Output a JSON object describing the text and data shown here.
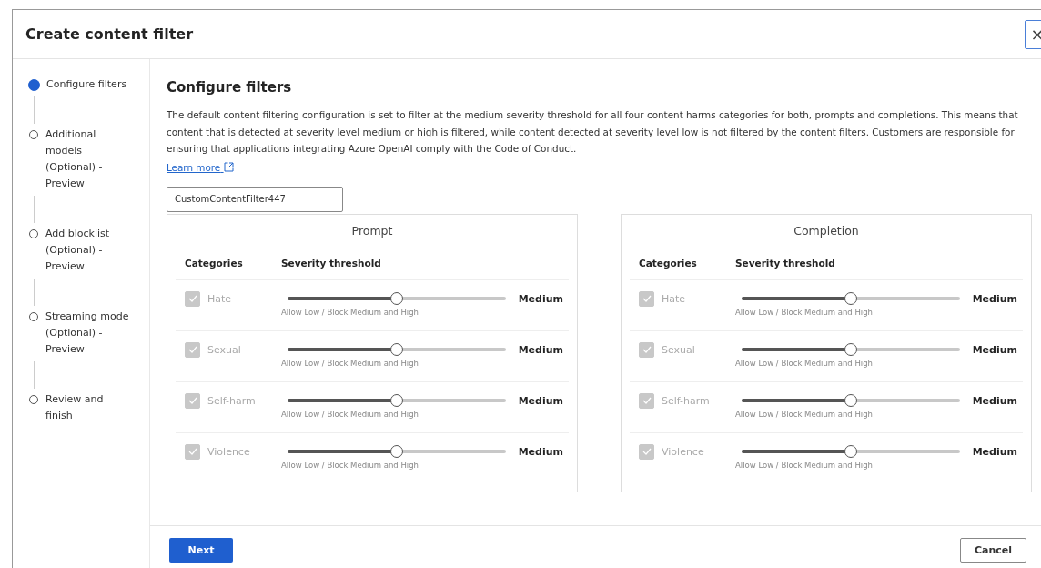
{
  "dialog": {
    "title": "Create content filter",
    "close": "×"
  },
  "steps": [
    {
      "label": "Configure filters",
      "selected": true
    },
    {
      "label": "Additional models (Optional) - Preview",
      "selected": false
    },
    {
      "label": "Add blocklist (Optional) - Preview",
      "selected": false
    },
    {
      "label": "Streaming mode (Optional) - Preview",
      "selected": false
    },
    {
      "label": "Review and finish",
      "selected": false
    }
  ],
  "heading": "Configure filters",
  "description": "The default content filtering configuration is set to filter at the medium severity threshold for all four content harms categories for both, prompts and completions. This means that content that is detected at severity level medium or high is filtered, while content detected at severity level low is not filtered by the content filters. Customers are responsible for ensuring that applications integrating Azure OpenAI comply with the Code of Conduct.",
  "learn_more": "Learn more",
  "name_field": {
    "value": "CustomContentFilter447"
  },
  "panels": [
    {
      "title": "Prompt",
      "columns": [
        "Categories",
        "Severity threshold"
      ],
      "rows": [
        {
          "category": "Hate",
          "checked": true,
          "disabled": true,
          "level": 0.5,
          "caption": "Allow Low / Block Medium and High",
          "reading": "Medium"
        },
        {
          "category": "Sexual",
          "checked": true,
          "disabled": true,
          "level": 0.5,
          "caption": "Allow Low / Block Medium and High",
          "reading": "Medium"
        },
        {
          "category": "Self-harm",
          "checked": true,
          "disabled": true,
          "level": 0.5,
          "caption": "Allow Low / Block Medium and High",
          "reading": "Medium"
        },
        {
          "category": "Violence",
          "checked": true,
          "disabled": true,
          "level": 0.5,
          "caption": "Allow Low / Block Medium and High",
          "reading": "Medium"
        }
      ]
    },
    {
      "title": "Completion",
      "columns": [
        "Categories",
        "Severity threshold"
      ],
      "rows": [
        {
          "category": "Hate",
          "checked": true,
          "disabled": true,
          "level": 0.5,
          "caption": "Allow Low / Block Medium and High",
          "reading": "Medium"
        },
        {
          "category": "Sexual",
          "checked": true,
          "disabled": true,
          "level": 0.5,
          "caption": "Allow Low / Block Medium and High",
          "reading": "Medium"
        },
        {
          "category": "Self-harm",
          "checked": true,
          "disabled": true,
          "level": 0.5,
          "caption": "Allow Low / Block Medium and High",
          "reading": "Medium"
        },
        {
          "category": "Violence",
          "checked": true,
          "disabled": true,
          "level": 0.5,
          "caption": "Allow Low / Block Medium and High",
          "reading": "Medium"
        }
      ]
    }
  ],
  "footer": {
    "primary": "Next",
    "secondary": "Cancel"
  }
}
